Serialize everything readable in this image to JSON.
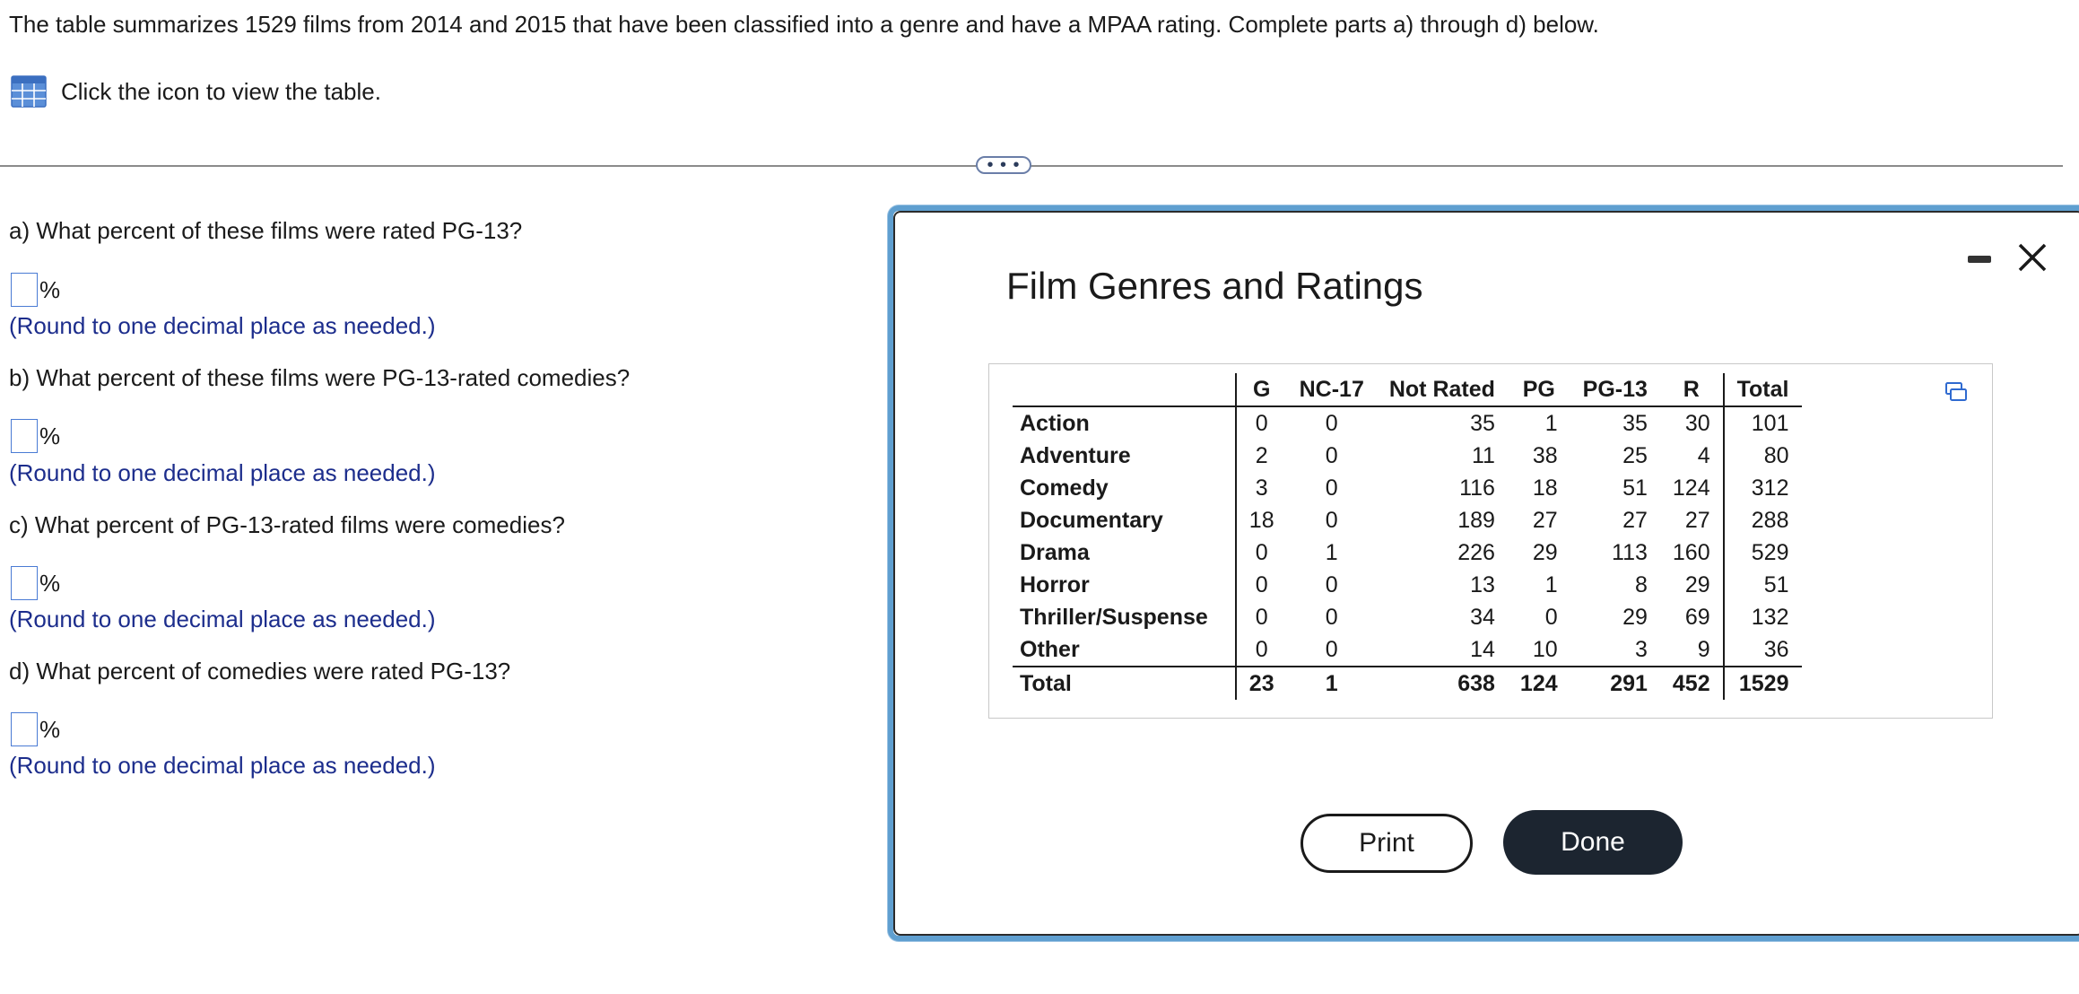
{
  "prompt": "The table summarizes 1529 films from 2014 and 2015 that have been classified into a genre and have a MPAA rating. Complete parts a) through d) below.",
  "view_table_label": "Click the icon to view the table.",
  "ellipsis": "• • •",
  "questions": [
    {
      "label": "a) What percent of these films were rated PG-13?",
      "unit": "%",
      "hint": "(Round to one decimal place as needed.)",
      "value": ""
    },
    {
      "label": "b) What percent of these films were PG-13-rated comedies?",
      "unit": "%",
      "hint": "(Round to one decimal place as needed.)",
      "value": ""
    },
    {
      "label": "c) What percent of PG-13-rated films were comedies?",
      "unit": "%",
      "hint": "(Round to one decimal place as needed.)",
      "value": ""
    },
    {
      "label": "d) What percent of comedies were rated PG-13?",
      "unit": "%",
      "hint": "(Round to one decimal place as needed.)",
      "value": ""
    }
  ],
  "modal": {
    "title": "Film Genres and Ratings",
    "print_label": "Print",
    "done_label": "Done",
    "table": {
      "columns": [
        "G",
        "NC-17",
        "Not Rated",
        "PG",
        "PG-13",
        "R",
        "Total"
      ],
      "rows": [
        {
          "genre": "Action",
          "values": [
            "0",
            "0",
            "35",
            "1",
            "35",
            "30",
            "101"
          ]
        },
        {
          "genre": "Adventure",
          "values": [
            "2",
            "0",
            "11",
            "38",
            "25",
            "4",
            "80"
          ]
        },
        {
          "genre": "Comedy",
          "values": [
            "3",
            "0",
            "116",
            "18",
            "51",
            "124",
            "312"
          ]
        },
        {
          "genre": "Documentary",
          "values": [
            "18",
            "0",
            "189",
            "27",
            "27",
            "27",
            "288"
          ]
        },
        {
          "genre": "Drama",
          "values": [
            "0",
            "1",
            "226",
            "29",
            "113",
            "160",
            "529"
          ]
        },
        {
          "genre": "Horror",
          "values": [
            "0",
            "0",
            "13",
            "1",
            "8",
            "29",
            "51"
          ]
        },
        {
          "genre": "Thriller/Suspense",
          "values": [
            "0",
            "0",
            "34",
            "0",
            "29",
            "69",
            "132"
          ]
        },
        {
          "genre": "Other",
          "values": [
            "0",
            "0",
            "14",
            "10",
            "3",
            "9",
            "36"
          ]
        }
      ],
      "total": {
        "genre": "Total",
        "values": [
          "23",
          "1",
          "638",
          "124",
          "291",
          "452",
          "1529"
        ]
      }
    }
  },
  "icons": {
    "table": "table-grid-icon",
    "minimize": "minimize-icon",
    "close": "close-icon",
    "copy": "copy-icon"
  },
  "colors": {
    "hint_text": "#1c2d8c",
    "input_border": "#4a7bd4",
    "modal_border": "#5f9fd0",
    "done_button": "#1c2530"
  }
}
